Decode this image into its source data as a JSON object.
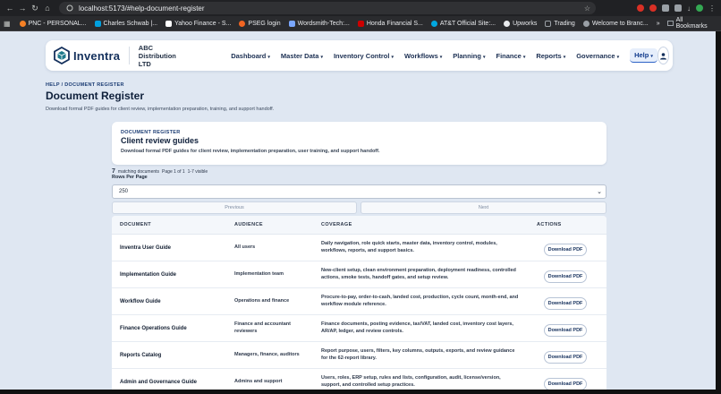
{
  "browser": {
    "url": "localhost:5173/#help-document-register",
    "bookmarks": [
      "PNC - PERSONAL...",
      "Charles Schwab |...",
      "Yahoo Finance - S...",
      "PSEG login",
      "Wordsmith-Tech:...",
      "Honda Financial S...",
      "AT&T Official Site:...",
      "Upworks",
      "Trading",
      "Welcome to Branc..."
    ],
    "overflow": "»",
    "all_bookmarks": "All Bookmarks",
    "colors": {
      "pnc": "#f58025",
      "schwab": "#00a0df",
      "yahoo": "#ffffff",
      "pseg": "#f26522",
      "wordsmith": "#7aa7ff",
      "honda": "#cc0000",
      "att": "#00a8e0",
      "upworks": "#e8eaed",
      "folder": "#9aa0a6",
      "welcome": "#9aa0a6"
    }
  },
  "header": {
    "brand": "Inventra",
    "tenant": "ABC Distribution LTD",
    "menu": [
      "Dashboard",
      "Master Data",
      "Inventory Control",
      "Workflows",
      "Planning",
      "Finance",
      "Reports",
      "Governance",
      "Help"
    ],
    "caret": "▾"
  },
  "page": {
    "breadcrumb": "HELP / DOCUMENT REGISTER",
    "title": "Document Register",
    "subtitle": "Download formal PDF guides for client review, implementation preparation, training, and support handoff."
  },
  "card": {
    "eyebrow": "DOCUMENT REGISTER",
    "title": "Client review guides",
    "description": "Download formal PDF guides for client review, implementation preparation, user training, and support handoff."
  },
  "pagination": {
    "count": "7",
    "count_label": "matching documents",
    "page_info": "Page 1 of 1",
    "visible": "1-7 visible",
    "rows_label": "Rows Per Page",
    "rows_value": "250",
    "previous": "Previous",
    "next": "Next"
  },
  "table": {
    "headers": [
      "DOCUMENT",
      "AUDIENCE",
      "COVERAGE",
      "ACTIONS"
    ],
    "action_label": "Download PDF",
    "rows": [
      {
        "doc": "Inventra User Guide",
        "aud1": "All users",
        "aud2": "",
        "cov1": "Daily navigation, role quick starts, master data, inventory control, modules,",
        "cov2": "workflows, reports, and support basics."
      },
      {
        "doc": "Implementation Guide",
        "aud1": "Implementation team",
        "aud2": "",
        "cov1": "New-client setup, clean environment preparation, deployment readiness, controlled",
        "cov2": "actions, smoke tests, handoff gates, and setup review."
      },
      {
        "doc": "Workflow Guide",
        "aud1": "Operations and finance",
        "aud2": "",
        "cov1": "Procure-to-pay, order-to-cash, landed cost, production, cycle count, month-end, and",
        "cov2": "workflow module reference."
      },
      {
        "doc": "Finance Operations Guide",
        "aud1": "Finance and accountant",
        "aud2": "reviewers",
        "cov1": "Finance documents, posting evidence, tax/VAT, landed cost, inventory cost layers,",
        "cov2": "AR/AP, ledger, and review controls."
      },
      {
        "doc": "Reports Catalog",
        "aud1": "Managers, finance, auditors",
        "aud2": "",
        "cov1": "Report purpose, users, filters, key columns, outputs, exports, and review guidance",
        "cov2": "for the 62-report library."
      },
      {
        "doc": "Admin and Governance Guide",
        "aud1": "Admins and support",
        "aud2": "",
        "cov1": "Users, roles, ERP setup, rules and lists, configuration, audit, license/version,",
        "cov2": "support, and controlled setup practices."
      }
    ]
  }
}
